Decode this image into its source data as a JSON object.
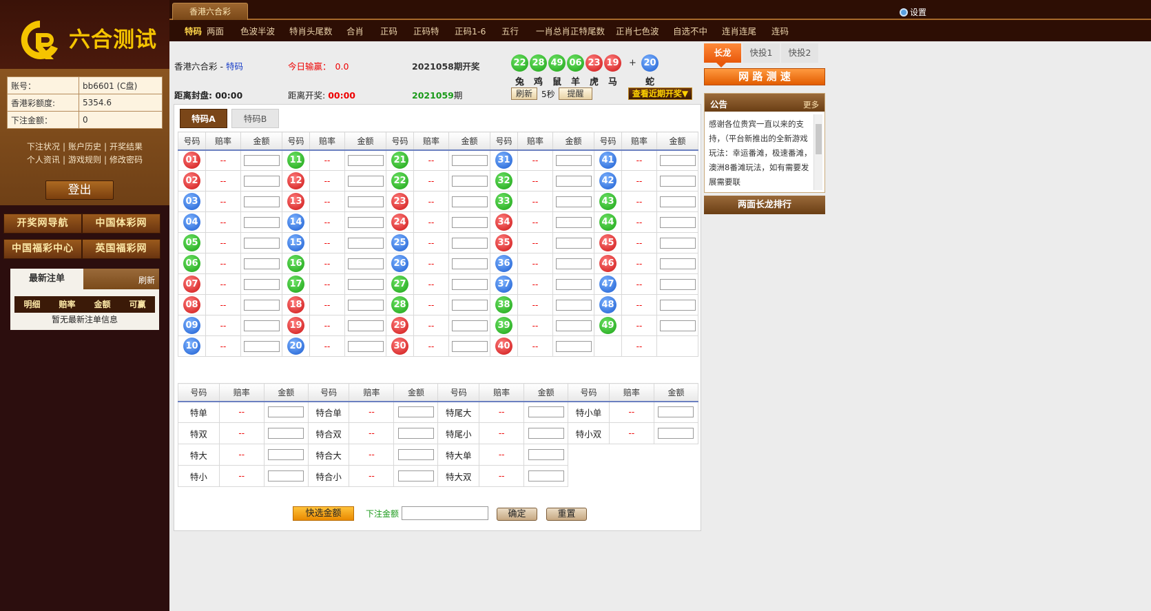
{
  "logo": {
    "text": "六合测试"
  },
  "account": {
    "rows": [
      {
        "k": "账号：",
        "v": "bb6601 (C盘)"
      },
      {
        "k": "香港彩额度:",
        "v": "5354.6"
      },
      {
        "k": "下注金额：",
        "v": "0"
      }
    ]
  },
  "links": {
    "line1": [
      "下注状况",
      "账户历史",
      "开奖结果"
    ],
    "line2": [
      "个人资讯",
      "游戏规则",
      "修改密码"
    ]
  },
  "logout": "登出",
  "sites": [
    "开奖网导航",
    "中国体彩网",
    "中国福彩中心",
    "英国福彩网"
  ],
  "recent": {
    "tab": "最新注单",
    "refresh": "刷新",
    "head": [
      "明细",
      "赔率",
      "金额",
      "可赢"
    ],
    "empty": "暂无最新注单信息"
  },
  "top": {
    "game_tab": "香港六合彩",
    "settings": "设置"
  },
  "nav": [
    "特码",
    "两面",
    "色波半波",
    "特肖头尾数",
    "合肖",
    "正码",
    "正码特",
    "正码1-6",
    "五行",
    "一肖总肖正特尾数",
    "正肖七色波",
    "自选不中",
    "连肖连尾",
    "连码"
  ],
  "header": {
    "game": "香港六合彩 - ",
    "play": "特码",
    "win_label": "今日输赢：",
    "win_value": "0.0",
    "last_issue": "2021058期开奖",
    "close_label": "距离封盘:",
    "close_time": "00:00",
    "open_label": "距离开奖:",
    "open_time": "00:00",
    "next_issue": "2021059",
    "next_suffix": "期",
    "refresh_btn": "刷新",
    "interval": "5秒",
    "remind_btn": "提醒",
    "history_btn": "查看近期开奖▼",
    "plus": "+"
  },
  "draw": {
    "balls": [
      {
        "n": "22",
        "c": "green",
        "z": "兔"
      },
      {
        "n": "28",
        "c": "green",
        "z": "鸡"
      },
      {
        "n": "49",
        "c": "green",
        "z": "鼠"
      },
      {
        "n": "06",
        "c": "green",
        "z": "羊"
      },
      {
        "n": "23",
        "c": "red",
        "z": "虎"
      },
      {
        "n": "19",
        "c": "red",
        "z": "马"
      }
    ],
    "special": {
      "n": "20",
      "c": "blue",
      "z": "蛇"
    }
  },
  "subtabs": [
    "特码A",
    "特码B"
  ],
  "grid": {
    "headers": [
      "号码",
      "赔率",
      "金额"
    ],
    "odds": "--",
    "columns": [
      [
        {
          "n": "01",
          "c": "red"
        },
        {
          "n": "02",
          "c": "red"
        },
        {
          "n": "03",
          "c": "blue"
        },
        {
          "n": "04",
          "c": "blue"
        },
        {
          "n": "05",
          "c": "green"
        },
        {
          "n": "06",
          "c": "green"
        },
        {
          "n": "07",
          "c": "red"
        },
        {
          "n": "08",
          "c": "red"
        },
        {
          "n": "09",
          "c": "blue"
        },
        {
          "n": "10",
          "c": "blue"
        }
      ],
      [
        {
          "n": "11",
          "c": "green"
        },
        {
          "n": "12",
          "c": "red"
        },
        {
          "n": "13",
          "c": "red"
        },
        {
          "n": "14",
          "c": "blue"
        },
        {
          "n": "15",
          "c": "blue"
        },
        {
          "n": "16",
          "c": "green"
        },
        {
          "n": "17",
          "c": "green"
        },
        {
          "n": "18",
          "c": "red"
        },
        {
          "n": "19",
          "c": "red"
        },
        {
          "n": "20",
          "c": "blue"
        }
      ],
      [
        {
          "n": "21",
          "c": "green"
        },
        {
          "n": "22",
          "c": "green"
        },
        {
          "n": "23",
          "c": "red"
        },
        {
          "n": "24",
          "c": "red"
        },
        {
          "n": "25",
          "c": "blue"
        },
        {
          "n": "26",
          "c": "blue"
        },
        {
          "n": "27",
          "c": "green"
        },
        {
          "n": "28",
          "c": "green"
        },
        {
          "n": "29",
          "c": "red"
        },
        {
          "n": "30",
          "c": "red"
        }
      ],
      [
        {
          "n": "31",
          "c": "blue"
        },
        {
          "n": "32",
          "c": "green"
        },
        {
          "n": "33",
          "c": "green"
        },
        {
          "n": "34",
          "c": "red"
        },
        {
          "n": "35",
          "c": "red"
        },
        {
          "n": "36",
          "c": "blue"
        },
        {
          "n": "37",
          "c": "blue"
        },
        {
          "n": "38",
          "c": "green"
        },
        {
          "n": "39",
          "c": "green"
        },
        {
          "n": "40",
          "c": "red"
        }
      ],
      [
        {
          "n": "41",
          "c": "blue"
        },
        {
          "n": "42",
          "c": "blue"
        },
        {
          "n": "43",
          "c": "green"
        },
        {
          "n": "44",
          "c": "green"
        },
        {
          "n": "45",
          "c": "red"
        },
        {
          "n": "46",
          "c": "red"
        },
        {
          "n": "47",
          "c": "blue"
        },
        {
          "n": "48",
          "c": "blue"
        },
        {
          "n": "49",
          "c": "green"
        },
        null
      ]
    ]
  },
  "twoside": {
    "headers": [
      "号码",
      "赔率",
      "金额"
    ],
    "odds": "--",
    "columns": [
      [
        "特单",
        "特双",
        "特大",
        "特小"
      ],
      [
        "特合单",
        "特合双",
        "特合大",
        "特合小"
      ],
      [
        "特尾大",
        "特尾小",
        "特大单",
        "特大双"
      ],
      [
        "特小单",
        "特小双"
      ]
    ]
  },
  "bottom": {
    "quick": "快选金额",
    "amount_label": "下注金额",
    "confirm": "确定",
    "reset": "重置"
  },
  "right": {
    "tabs": [
      "长龙",
      "快投1",
      "快投2"
    ],
    "speed": "网 路 测 速",
    "notice_title": "公告",
    "notice_more": "更多",
    "notice_text": "感谢各位贵宾一直以来的支持，（平台新推出的全新游戏玩法：幸运番滩，极速番滩，澳洲8番滩玩法，如有需要发展需要联",
    "dragon": "两面长龙排行"
  }
}
